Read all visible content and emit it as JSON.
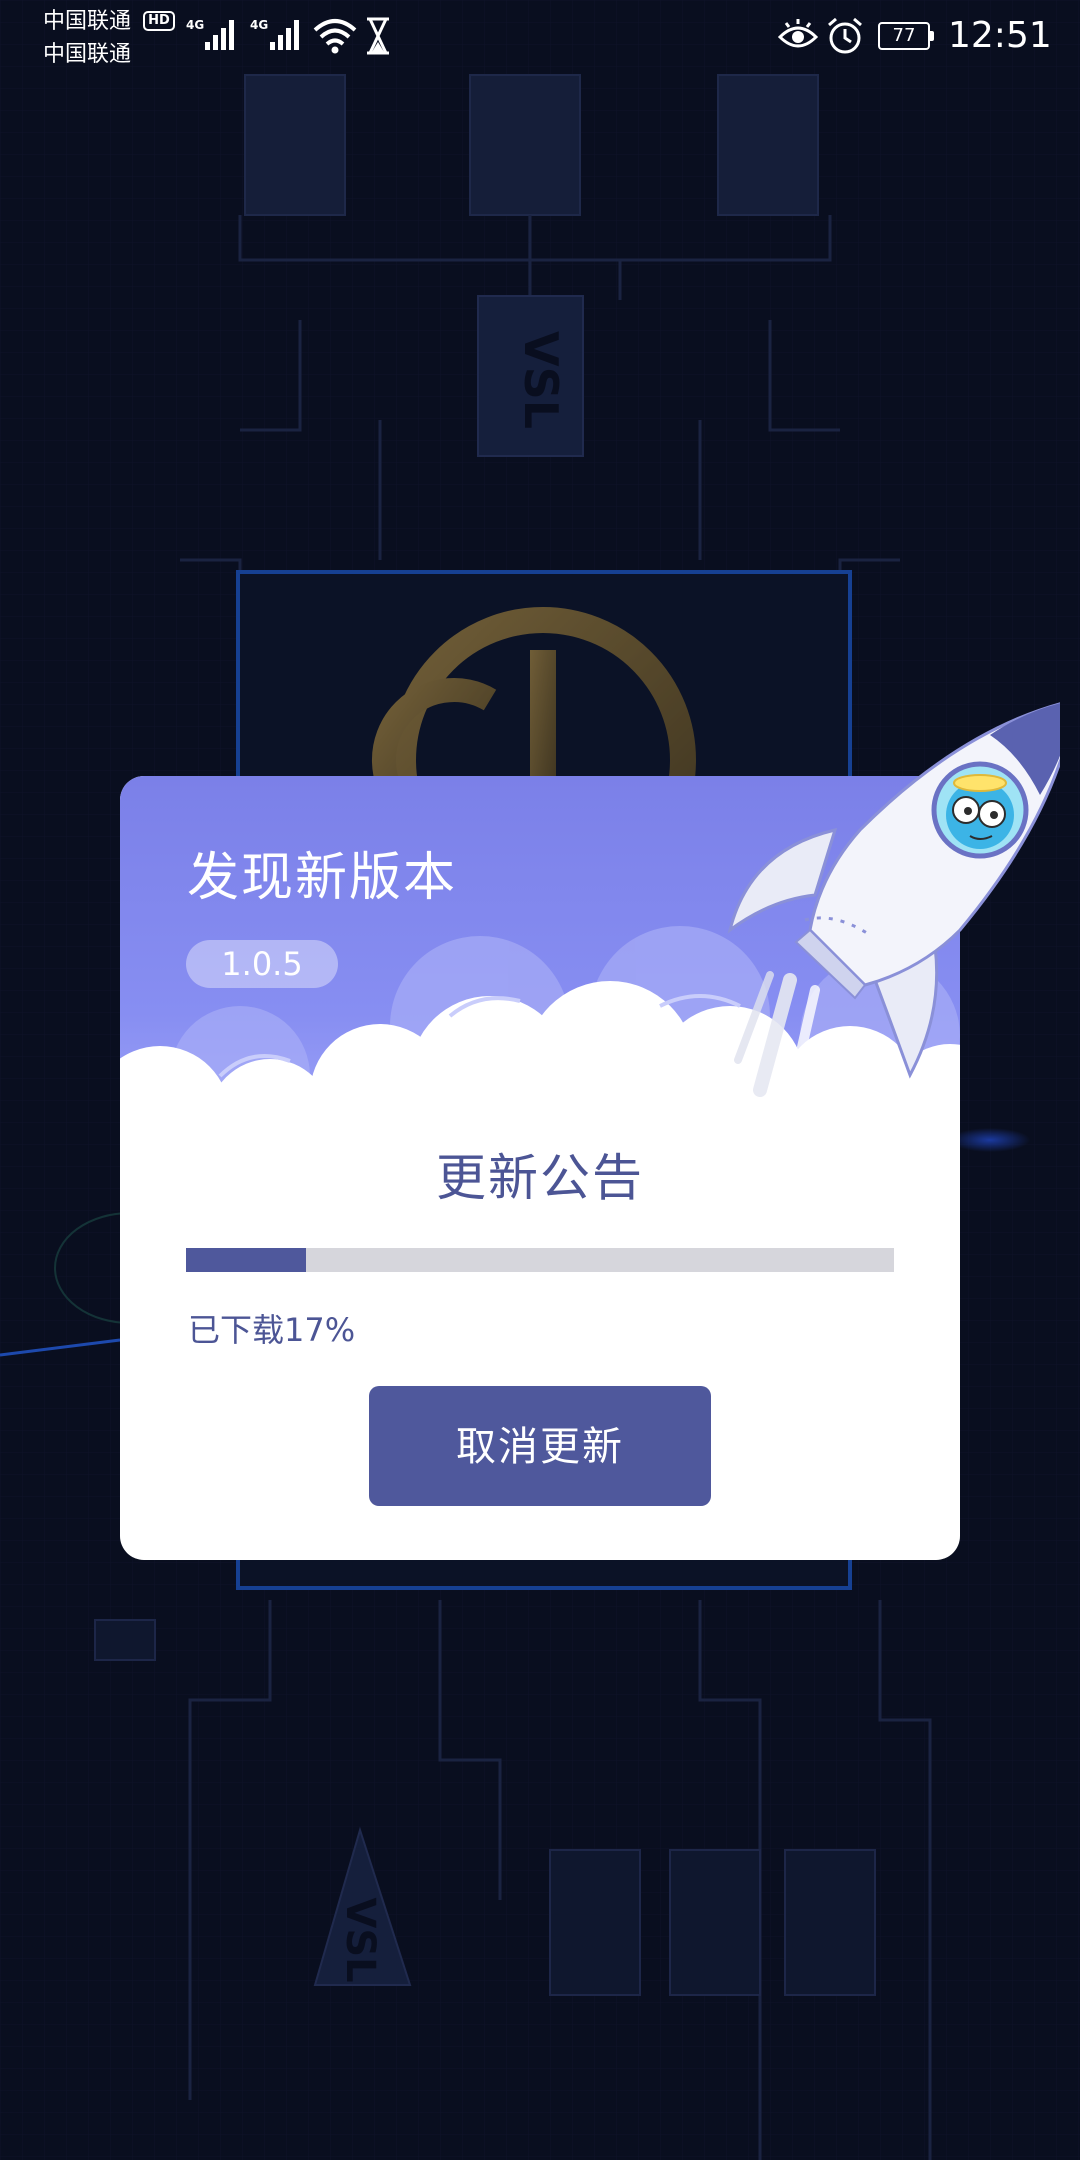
{
  "status_bar": {
    "carrier_1": "中国联通",
    "carrier_2": "中国联通",
    "hd_badge": "HD",
    "net_1": "4G",
    "net_2": "4G",
    "battery": "77",
    "time": "12:51",
    "icons": [
      "signal-icon",
      "signal-icon",
      "wifi-icon",
      "hourglass-icon",
      "eye-icon",
      "alarm-icon",
      "battery-icon"
    ]
  },
  "background": {
    "chip_logo": "VSL"
  },
  "dialog": {
    "title": "发现新版本",
    "version": "1.0.5",
    "notice_title": "更新公告",
    "progress": 0.17,
    "progress_text": "已下载17%",
    "cancel_label": "取消更新"
  },
  "colors": {
    "background": "#0c1226",
    "header_gradient_top": "#7b80e8",
    "accent": "#4f589c",
    "progress_track": "#d6d6dc",
    "text_primary": "#4c5595"
  }
}
